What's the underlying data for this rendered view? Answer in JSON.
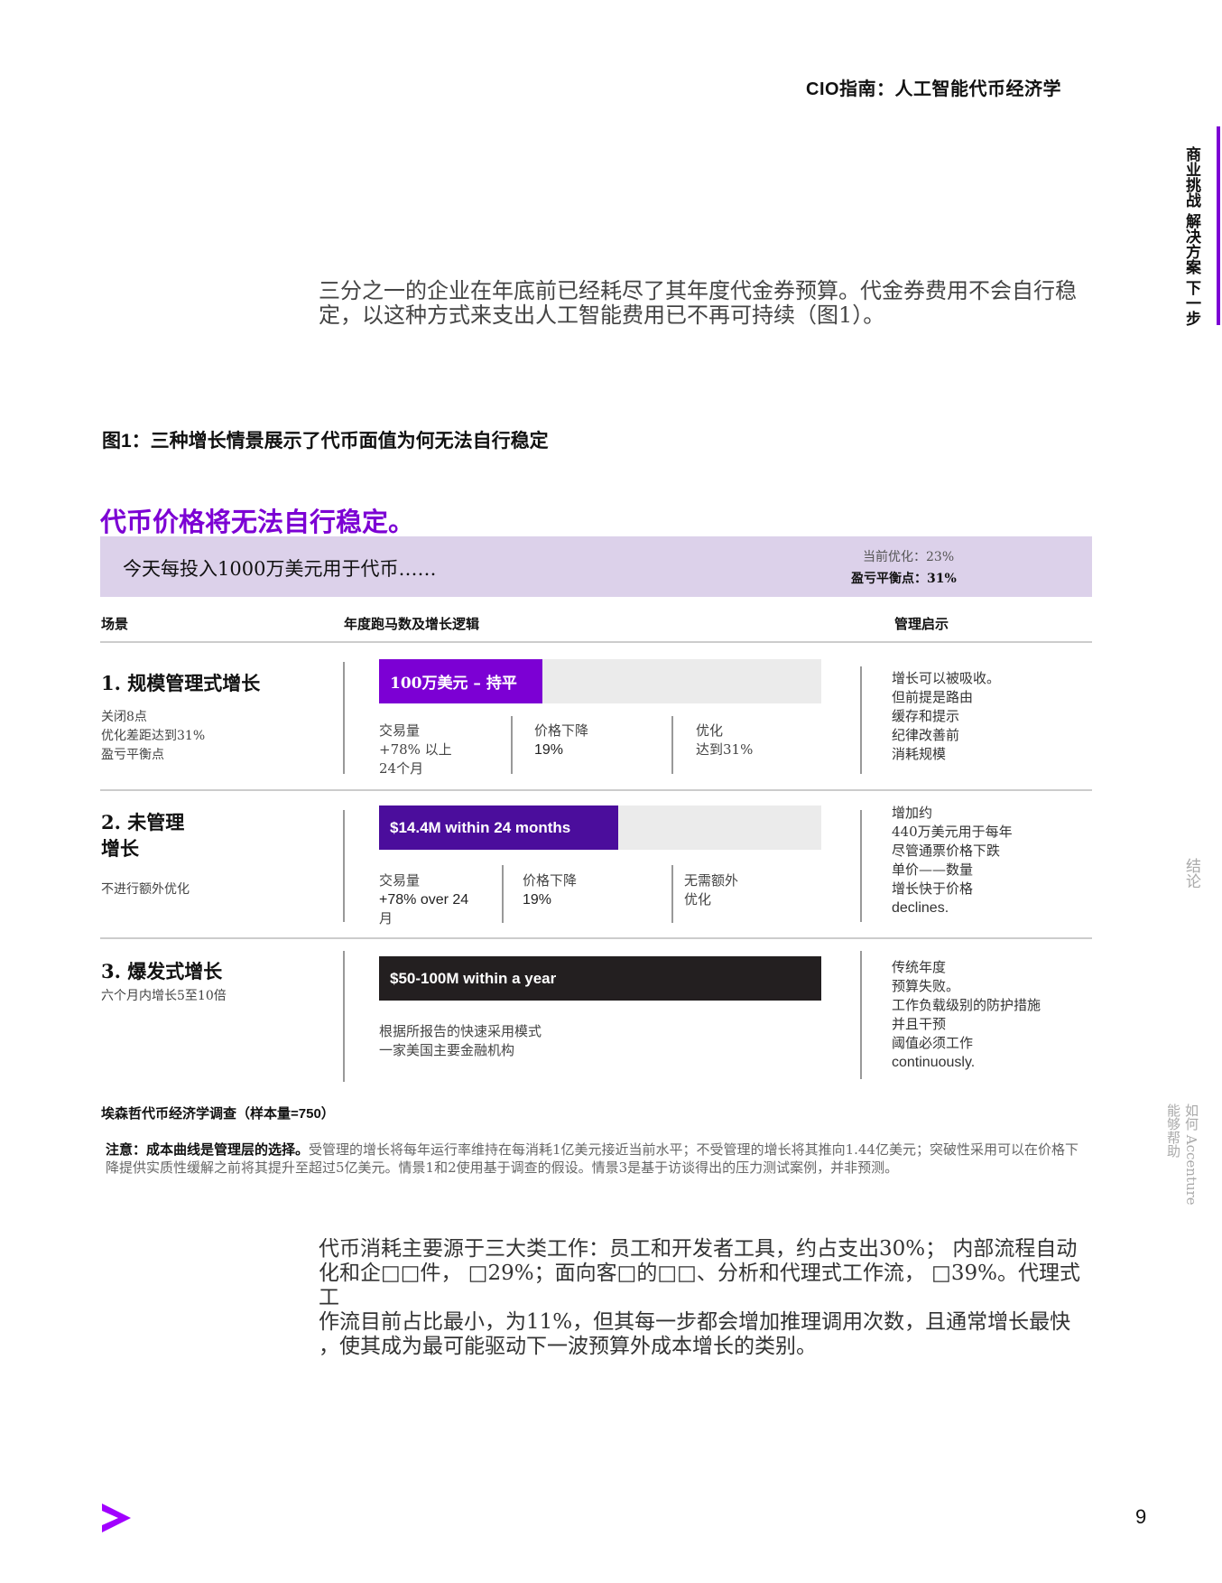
{
  "header": {
    "title": "CIO指南：人工智能代币经济学",
    "top_tiny": ""
  },
  "side_nav": {
    "active": "商业挑战 解决方案 下一步",
    "conclusion": "结论",
    "help_line1": "能够帮助",
    "help_line2": "如何 Accenture",
    "accent_color": "#7c00d4"
  },
  "intro": "三分之一的企业在年底前已经耗尽了其年度代金券预算。代金券费用不会自行稳定，以这种方式来支出人工智能费用已不再可持续（图1）。",
  "figure": {
    "caption": "图1：三种增长情景展示了代币面值为何无法自行稳定",
    "headline": "代币价格将无法自行稳定。",
    "banner": {
      "text": "今天每投入1000万美元用于代币……",
      "current": "当前优化：23%",
      "breakeven": "盈亏平衡点：31%",
      "color": "#dcd1ea"
    },
    "columns": {
      "scenario": "场景",
      "tokens": "年度跑马数及增长逻辑",
      "mgmt": "管理启示"
    },
    "scenarios": [
      {
        "title": "1.  规模管理式增长",
        "desc": [
          "关闭8点",
          "优化差距达到31%",
          "盈亏平衡点"
        ],
        "bar_label": "100万美元 – 持平",
        "bar_fraction": 0.37,
        "bar_color": "#7c00d4",
        "metrics": [
          {
            "label": "交易量",
            "value": "+78% 以上",
            "extra": "24个月"
          },
          {
            "label": "价格下降",
            "value": "19%",
            "extra": ""
          },
          {
            "label": "优化",
            "value": "达到31%",
            "extra": ""
          }
        ],
        "mgmt": [
          "增长可以被吸收。",
          "但前提是路由",
          "缓存和提示",
          "纪律改善前",
          "消耗规模"
        ]
      },
      {
        "title1": "2.  未管理",
        "title2": "增长",
        "desc": [
          "不进行额外优化"
        ],
        "bar_label": "$14.4M within 24 months",
        "bar_fraction": 0.54,
        "bar_color": "#4b0d9c",
        "metrics": [
          {
            "label": "交易量",
            "value": "+78% over 24",
            "extra": "月"
          },
          {
            "label": "价格下降",
            "value": "19%",
            "extra": ""
          },
          {
            "label": "无需额外",
            "value": "优化",
            "extra": ""
          }
        ],
        "mgmt": [
          "增加约",
          "440万美元用于每年",
          "尽管通票价格下跌",
          "单价——数量",
          "增长快于价格",
          "declines."
        ]
      },
      {
        "title": "3.  爆发式增长",
        "desc": [
          "六个月内增长5至10倍"
        ],
        "bar_label": "$50-100M within a year",
        "bar_fraction": 1.0,
        "bar_color": "#231f20",
        "basis": [
          "根据所报告的快速采用模式",
          "一家美国主要金融机构"
        ],
        "mgmt": [
          "传统年度",
          "预算失败。",
          "工作负载级别的防护措施",
          "并且干预",
          "阈值必须工作",
          "continuously."
        ]
      }
    ],
    "source": "埃森哲代币经济学调查（样本量=750）",
    "note_bold": "注意：成本曲线是管理层的选择。",
    "note_rest": "受管理的增长将每年运行率维持在每消耗1亿美元接近当前水平；不受管理的增长将其推向1.44亿美元；突破性采用可以在价格下降提供实质性缓解之前将其提升至超过5亿美元。情景1和2使用基于调查的假设。情景3是基于访谈得出的压力测试案例，并非预测。"
  },
  "body": {
    "p1": "代币消耗主要源于三大类工作：员工和开发者工具，约占支出30%； 内部流程自动",
    "p2": "化和企□□件，  □29%；面向客□的□□、分析和代理式工作流，  □39%。代理式工",
    "p3": "作流目前占比最小，为11%，但其每一步都会增加推理调用次数，且通常增长最快",
    "p4": "，使其成为最可能驱动下一波预算外成本增长的类别。"
  },
  "footer": {
    "page_number": "9",
    "logo": "accenture-chevron-logo",
    "logo_color": "#a100ff"
  }
}
